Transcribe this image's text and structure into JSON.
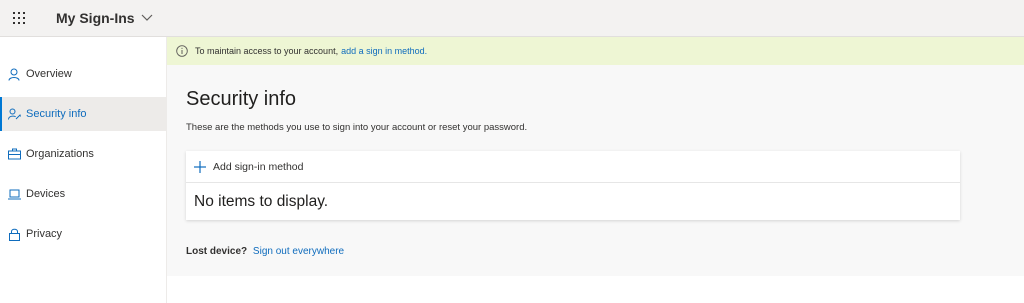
{
  "header": {
    "app_title": "My Sign-Ins",
    "waffle_icon": "waffle-icon",
    "chevron_icon": "chevron-down-icon"
  },
  "sidebar": {
    "items": [
      {
        "label": "Overview",
        "icon": "person-icon",
        "active": false
      },
      {
        "label": "Security info",
        "icon": "security-info-icon",
        "active": true
      },
      {
        "label": "Organizations",
        "icon": "briefcase-icon",
        "active": false
      },
      {
        "label": "Devices",
        "icon": "laptop-icon",
        "active": false
      },
      {
        "label": "Privacy",
        "icon": "lock-icon",
        "active": false
      }
    ]
  },
  "banner": {
    "text": "To maintain access to your account,",
    "link": "add a sign in method.",
    "icon": "info-icon"
  },
  "main": {
    "title": "Security info",
    "description": "These are the methods you use to sign into your account or reset your password.",
    "add_method_label": "Add sign-in method",
    "empty_text": "No items to display.",
    "lost_device_label": "Lost device?",
    "sign_out_link": "Sign out everywhere"
  },
  "colors": {
    "accent": "#0078d4",
    "link": "#0f6cbd",
    "banner_bg": "#eef6d4"
  }
}
